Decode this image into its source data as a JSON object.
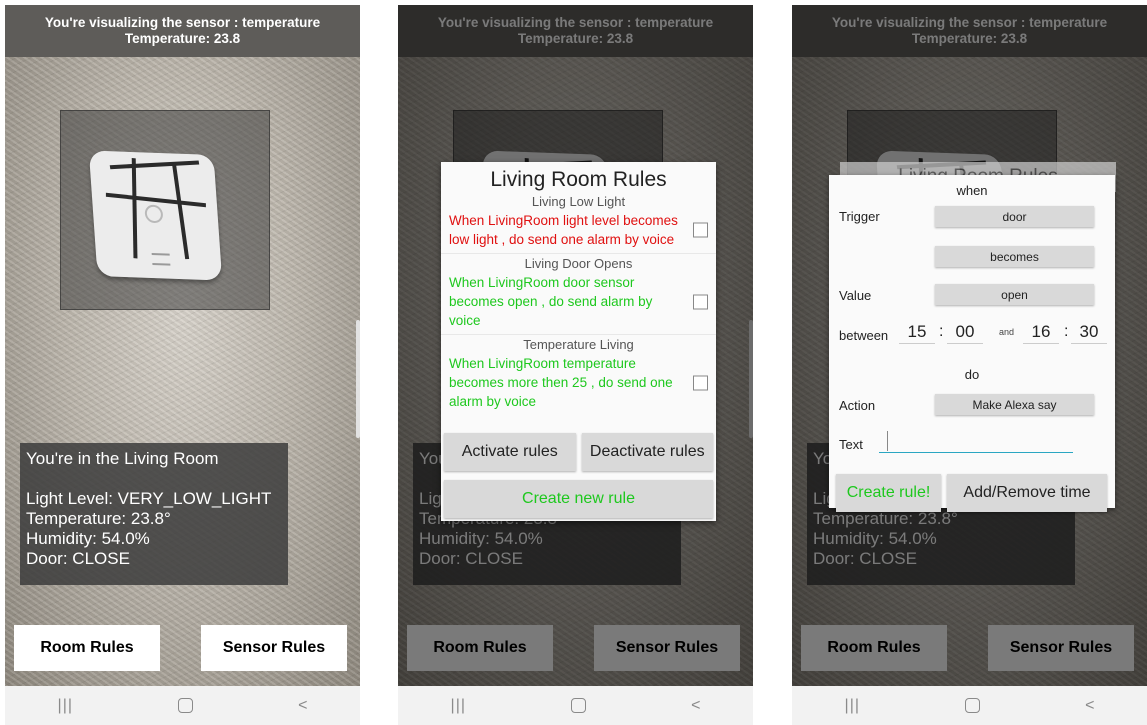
{
  "header": {
    "line1": "You're visualizing the sensor : temperature",
    "line2": "Temperature: 23.8"
  },
  "info": {
    "room": "You're in the Living Room",
    "light": "Light Level: VERY_LOW_LIGHT",
    "temperature": "Temperature: 23.8°",
    "humidity": "Humidity: 54.0%",
    "door": "Door: CLOSE"
  },
  "buttons": {
    "room_rules": "Room Rules",
    "sensor_rules": "Sensor Rules"
  },
  "navbar": {
    "recents": "|||",
    "back": "<"
  },
  "rules_dialog": {
    "title": "Living Room Rules",
    "rules": [
      {
        "name": "Living Low Light",
        "text": "When  LivingRoom light level becomes  low light  , do send  one alarm  by voice",
        "color": "red"
      },
      {
        "name": "Living Door Opens",
        "text": "When  LivingRoom door sensor becomes  open  , do send  alarm by voice",
        "color": "green"
      },
      {
        "name": "Temperature Living",
        "text": "When  LivingRoom temperature becomes  more then  25  , do send  one  alarm  by voice",
        "color": "green"
      }
    ],
    "activate": "Activate rules",
    "deactivate": "Deactivate rules",
    "create": "Create new rule"
  },
  "create_dialog": {
    "behind_title": "Living Room Rules",
    "when": "when",
    "trigger_label": "Trigger",
    "trigger_value": "door",
    "condition_value": "becomes",
    "value_label": "Value",
    "value_value": "open",
    "between_label": "between",
    "start_hour": "15",
    "start_min": "00",
    "and_label": "and",
    "end_hour": "16",
    "end_min": "30",
    "do_label": "do",
    "action_label": "Action",
    "action_value": "Make Alexa say",
    "text_label": "Text",
    "text_value": "",
    "create_button": "Create rule!",
    "time_button": "Add/Remove time"
  },
  "colors": {
    "red": "#e01010",
    "green": "#1ec81e",
    "accent": "#2aa6c2"
  }
}
